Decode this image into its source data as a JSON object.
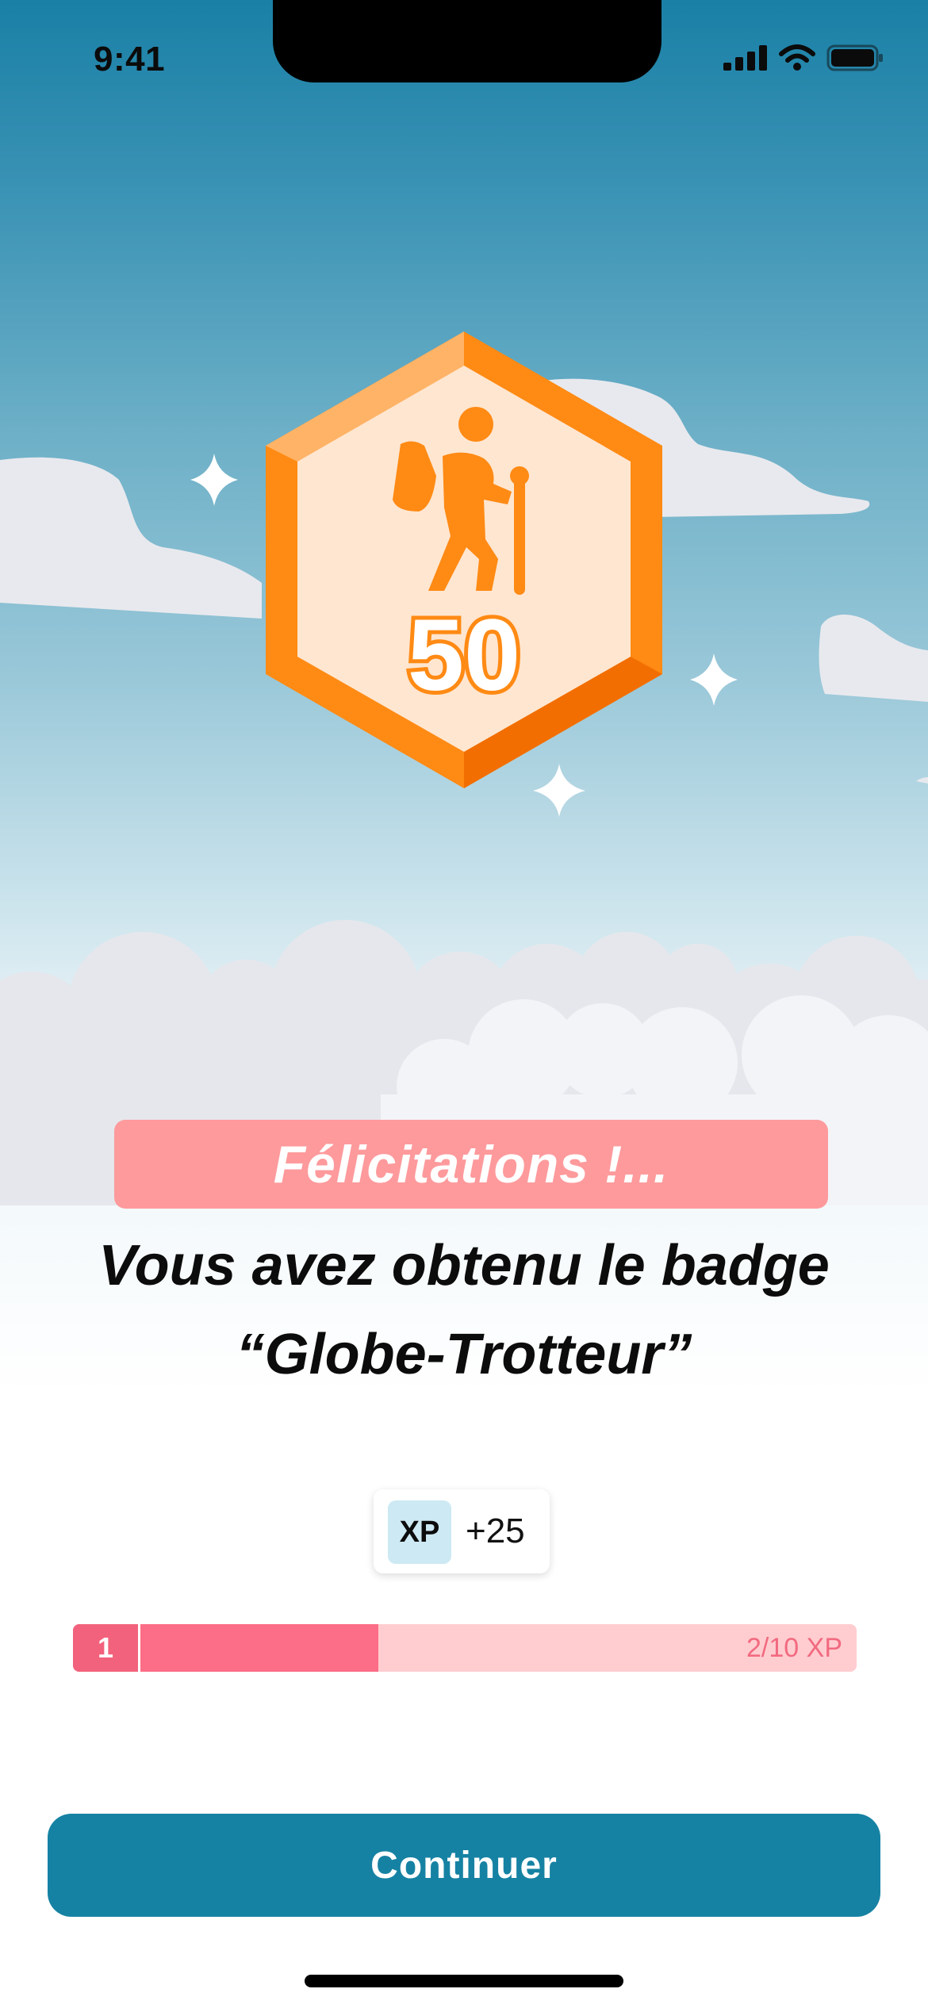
{
  "status_bar": {
    "time": "9:41"
  },
  "badge": {
    "icon": "hiker-icon",
    "number": "50"
  },
  "banner": {
    "text": "Félicitations !..."
  },
  "headline": {
    "line1": "Vous avez obtenu le badge",
    "line2": "“Globe-Trotteur”"
  },
  "xp_reward": {
    "label": "XP",
    "value": "+25"
  },
  "progress": {
    "level": "1",
    "current": 2,
    "max": 10,
    "text": "2/10 XP",
    "fill_fraction": 0.39
  },
  "continue_button": {
    "label": "Continuer"
  },
  "colors": {
    "accent": "#1682a3",
    "banner": "#fe9a9c",
    "badge_orange": "#ff8a14",
    "progress": "#fc6d87",
    "progress_track": "#ffcdd0"
  }
}
